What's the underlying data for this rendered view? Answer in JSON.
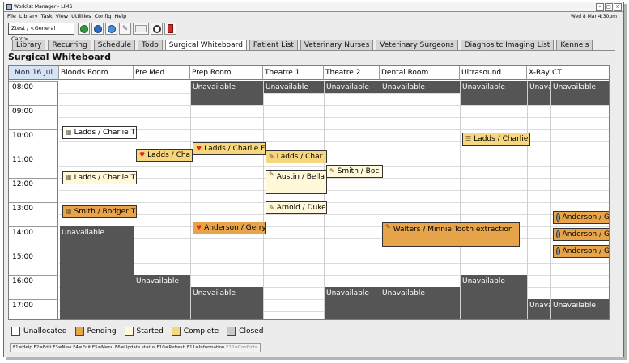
{
  "window": {
    "title": "Worklist Manager - LIMS",
    "clock": "Wed 8 Mar 4:30pm"
  },
  "menu": [
    "File",
    "Library",
    "Task",
    "View",
    "Utilities",
    "Config",
    "Help"
  ],
  "toolbar": {
    "card_select": "Ztest / <General Card>",
    "buttons": [
      "add-icon",
      "info-icon",
      "help-icon",
      "edit-icon",
      "form-icon",
      "refresh-icon",
      "exit-icon"
    ]
  },
  "tabs": [
    "Library",
    "Recurring",
    "Schedule",
    "Todo",
    "Surgical Whiteboard",
    "Patient List",
    "Veterinary Nurses",
    "Veterinary Surgeons",
    "Diagnositc Imaging List",
    "Kennels"
  ],
  "active_tab": "Surgical Whiteboard",
  "page_title": "Surgical Whiteboard",
  "grid": {
    "date": "Mon 16 Jul",
    "columns": [
      "Bloods Room",
      "Pre Med",
      "Prep Room",
      "Theatre 1",
      "Theatre 2",
      "Dental Room",
      "Ultrasound",
      "X-Ray",
      "CT"
    ],
    "times": [
      "08:00",
      "09:00",
      "10:00",
      "11:00",
      "12:00",
      "13:00",
      "14:00",
      "15:00",
      "16:00",
      "17:00"
    ],
    "unavailable_label": "Unavailable",
    "xray_truncated_label": "Unava"
  },
  "appointments": [
    {
      "id": "bloods-1",
      "label": "Ladds / Charlie T",
      "icon": "paw-icon",
      "status": "unallocated"
    },
    {
      "id": "bloods-2",
      "label": "Ladds / Charlie T",
      "icon": "paw-icon",
      "status": "started"
    },
    {
      "id": "bloods-3",
      "label": "Smith / Bodger T",
      "icon": "paw-icon",
      "status": "pending"
    },
    {
      "id": "premed-1",
      "label": "Ladds / Cha",
      "icon": "heart-icon",
      "status": "complete"
    },
    {
      "id": "prep-1",
      "label": "Ladds / Charlie F",
      "icon": "heart-icon",
      "status": "complete"
    },
    {
      "id": "prep-2",
      "label": "Anderson / Gerry",
      "icon": "heart-icon",
      "status": "pending"
    },
    {
      "id": "theatre1-1",
      "label": "Ladds / Char",
      "icon": "syringe-icon",
      "status": "complete"
    },
    {
      "id": "theatre1-2",
      "label": "Austin / Bella",
      "icon": "syringe-icon",
      "status": "started"
    },
    {
      "id": "theatre1-3",
      "label": "Arnold / Duke",
      "icon": "syringe-icon",
      "status": "started"
    },
    {
      "id": "theatre2-1",
      "label": "Smith / Boc",
      "icon": "syringe-icon",
      "status": "started"
    },
    {
      "id": "dental-1",
      "label": "Walters / Minnie Tooth extraction",
      "icon": "syringe-icon",
      "status": "pending"
    },
    {
      "id": "ultrasound-1",
      "label": "Ladds / Charlie",
      "icon": "probe-icon",
      "status": "complete"
    },
    {
      "id": "ct-1",
      "label": "Anderson / G",
      "icon": "avatar-icon",
      "status": "pending"
    },
    {
      "id": "ct-2",
      "label": "Anderson / G",
      "icon": "avatar-icon",
      "status": "pending"
    },
    {
      "id": "ct-3",
      "label": "Anderson / G",
      "icon": "avatar-icon",
      "status": "pending"
    }
  ],
  "legend": [
    {
      "label": "Unallocated",
      "color": "#ffffff"
    },
    {
      "label": "Pending",
      "color": "#e8a44a"
    },
    {
      "label": "Started",
      "color": "#fff8d9"
    },
    {
      "label": "Complete",
      "color": "#f7d77d"
    },
    {
      "label": "Closed",
      "color": "#c8c8c8"
    }
  ],
  "statusbar": {
    "shortcuts": "F1=Help  F2=Edit  F3=New  F4=Edit  F5=Menu  F6=Update status  F10=Refresh  F11=Information",
    "disabled": "F12=Conflicts"
  }
}
